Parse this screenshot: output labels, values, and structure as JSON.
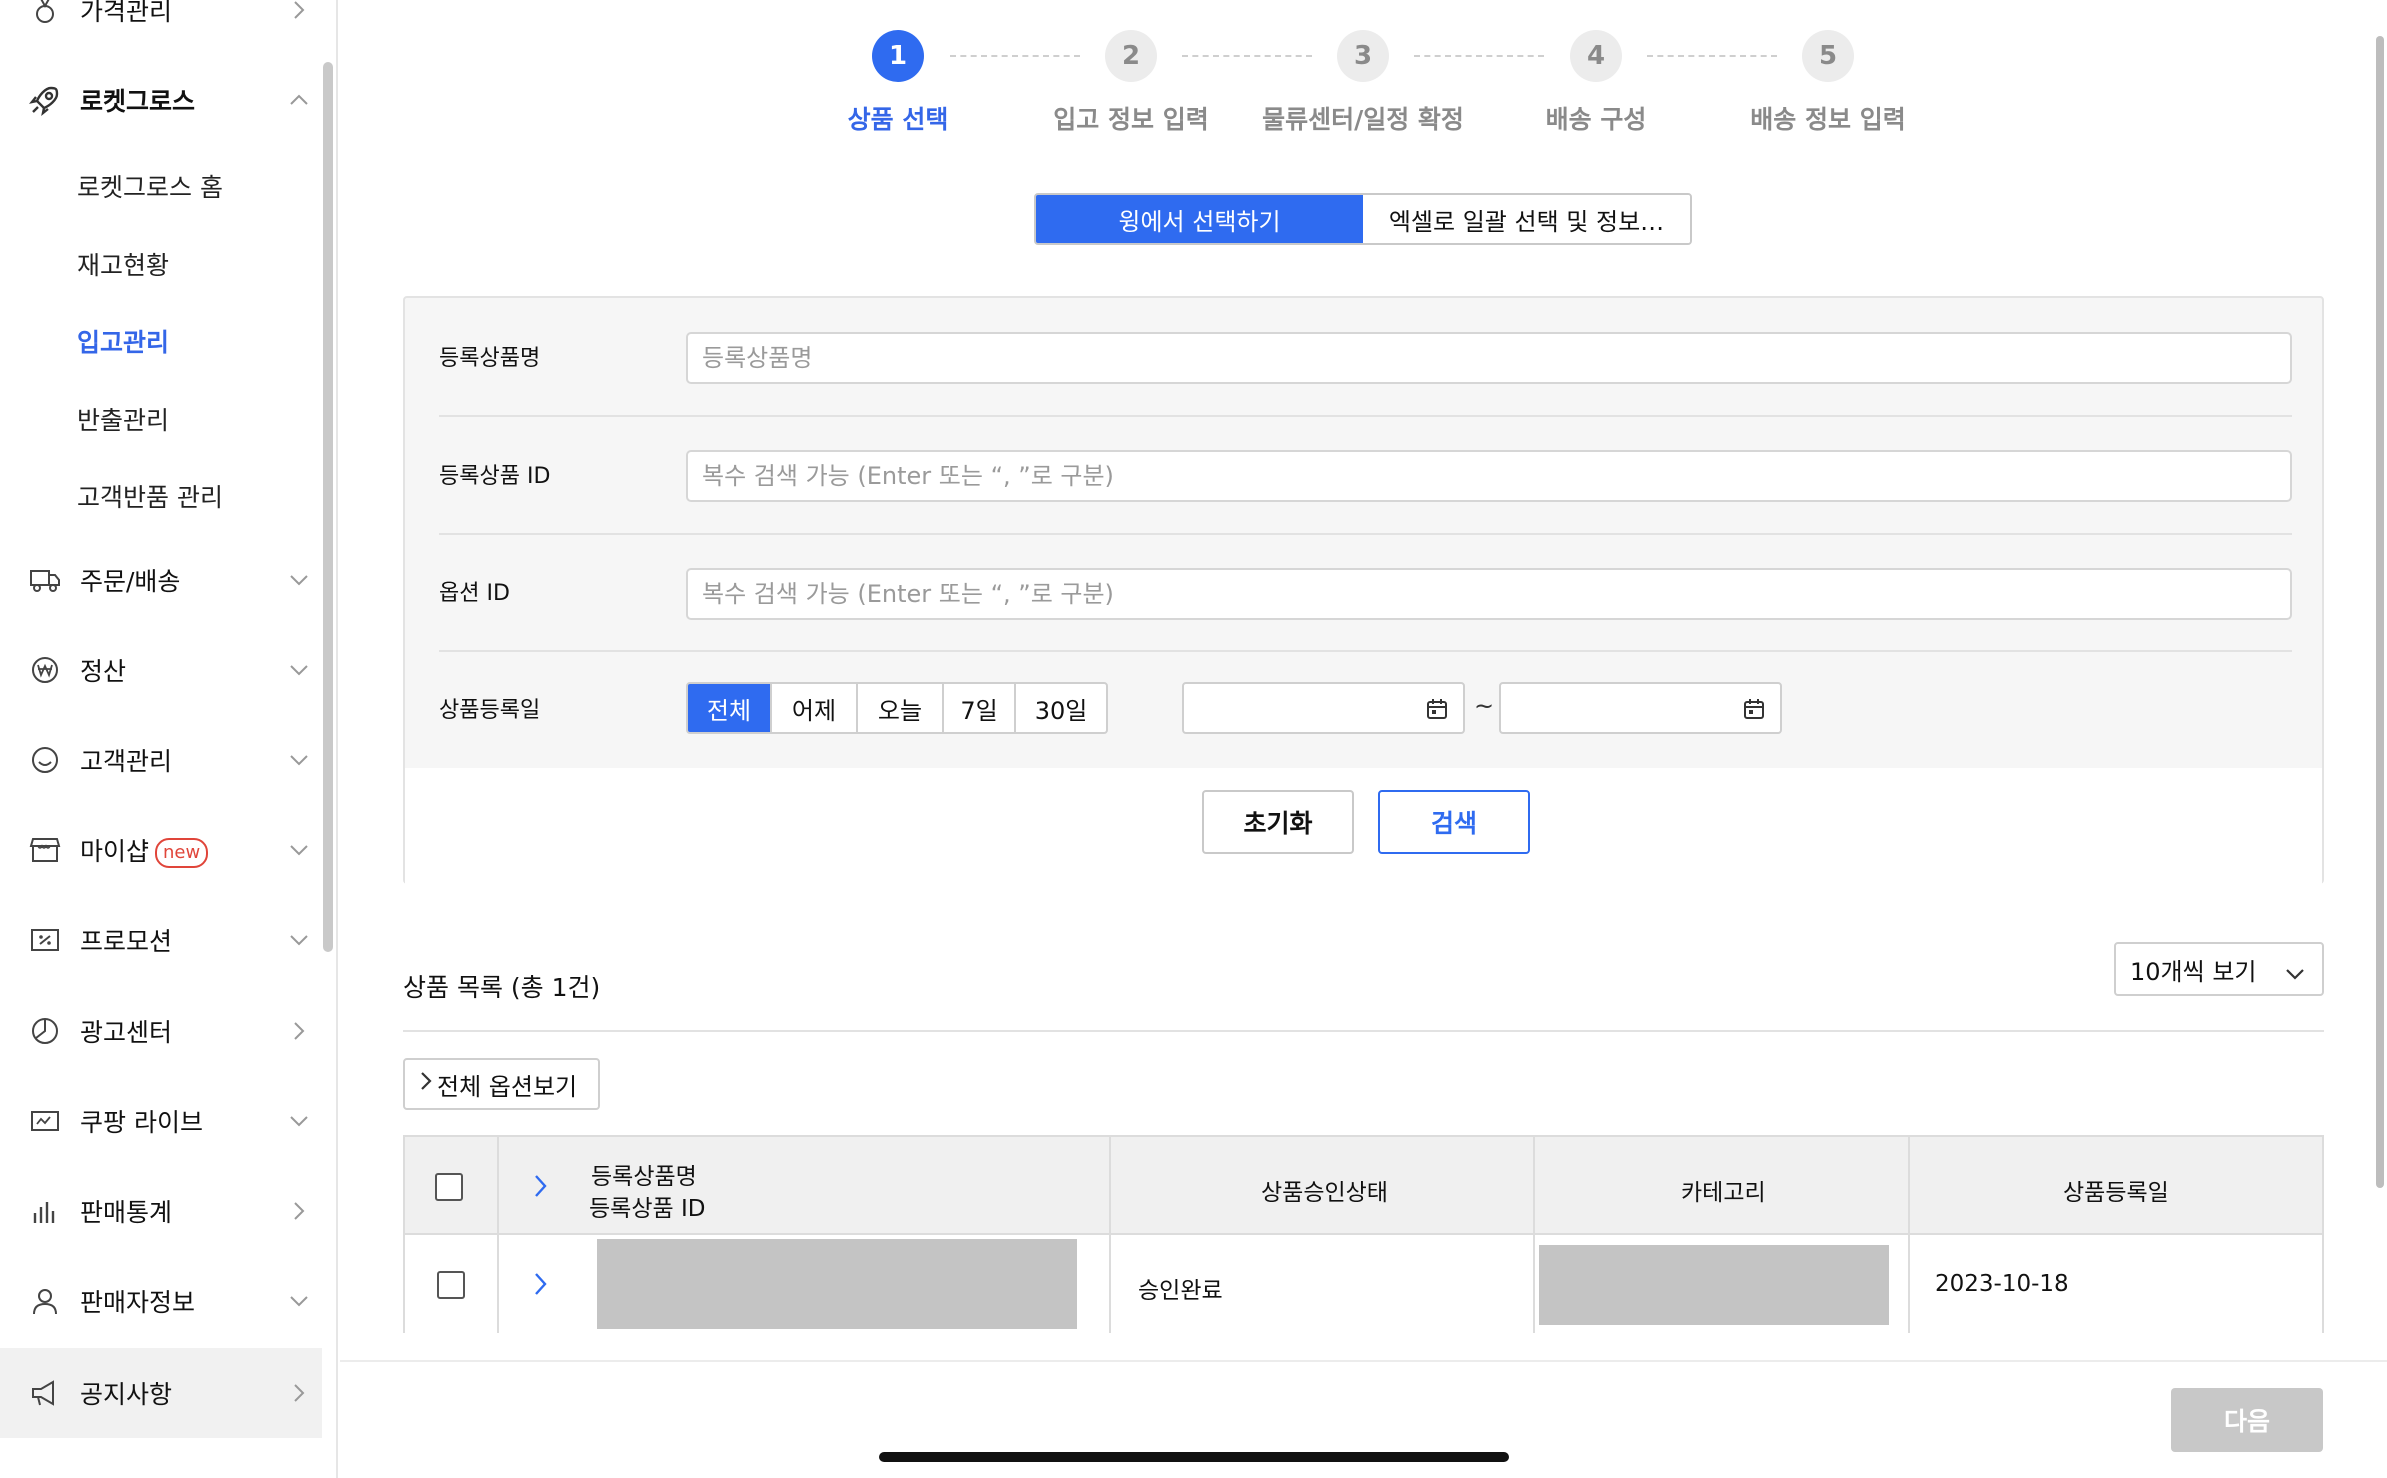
{
  "sidebar": {
    "items": [
      {
        "label": "가격관리",
        "icon": "medal-icon"
      },
      {
        "label": "로켓그로스",
        "icon": "rocket-icon"
      },
      {
        "label": "주문/배송",
        "icon": "truck-icon"
      },
      {
        "label": "정산",
        "icon": "won-icon"
      },
      {
        "label": "고객관리",
        "icon": "smile-icon"
      },
      {
        "label": "마이샵",
        "icon": "shop-icon",
        "badge": "new"
      },
      {
        "label": "프로모션",
        "icon": "coupon-icon"
      },
      {
        "label": "광고센터",
        "icon": "pie-icon"
      },
      {
        "label": "쿠팡 라이브",
        "icon": "live-icon"
      },
      {
        "label": "판매통계",
        "icon": "bar-chart-icon"
      },
      {
        "label": "판매자정보",
        "icon": "person-icon"
      },
      {
        "label": "공지사항",
        "icon": "megaphone-icon"
      }
    ],
    "sub_items": [
      "로켓그로스 홈",
      "재고현황",
      "입고관리",
      "반출관리",
      "고객반품 관리"
    ],
    "current_sub": "입고관리"
  },
  "stepper": {
    "steps": [
      {
        "num": "1",
        "label": "상품 선택",
        "active": true
      },
      {
        "num": "2",
        "label": "입고 정보 입력"
      },
      {
        "num": "3",
        "label": "물류센터/일정 확정"
      },
      {
        "num": "4",
        "label": "배송 구성"
      },
      {
        "num": "5",
        "label": "배송 정보 입력"
      }
    ]
  },
  "tabs": [
    "윙에서 선택하기",
    "엑셀로 일괄 선택 및 정보…"
  ],
  "search": {
    "rows": [
      {
        "label": "등록상품명",
        "placeholder": "등록상품명"
      },
      {
        "label": "등록상품 ID",
        "placeholder": "복수 검색 가능 (Enter 또는 “, ”로 구분)"
      },
      {
        "label": "옵션 ID",
        "placeholder": "복수 검색 가능 (Enter 또는 “, ”로 구분)"
      }
    ],
    "date_label": "상품등록일",
    "date_ranges": [
      "전체",
      "어제",
      "오늘",
      "7일",
      "30일"
    ],
    "date_range_selected": "전체",
    "tilde": "~",
    "reset_label": "초기화",
    "search_label": "검색"
  },
  "list": {
    "title": "상품 목록 (총 1건)",
    "page_size": "10개씩 보기",
    "all_options": "전체 옵션보기",
    "columns": {
      "name_line1": "등록상품명",
      "name_line2": "등록상품 ID",
      "status": "상품승인상태",
      "category": "카테고리",
      "reg_date": "상품등록일"
    },
    "rows": [
      {
        "status": "승인완료",
        "reg_date": "2023-10-18"
      }
    ]
  },
  "footer": {
    "next_label": "다음"
  },
  "colors": {
    "accent": "#2f6bf0",
    "badge": "#e0453a"
  }
}
